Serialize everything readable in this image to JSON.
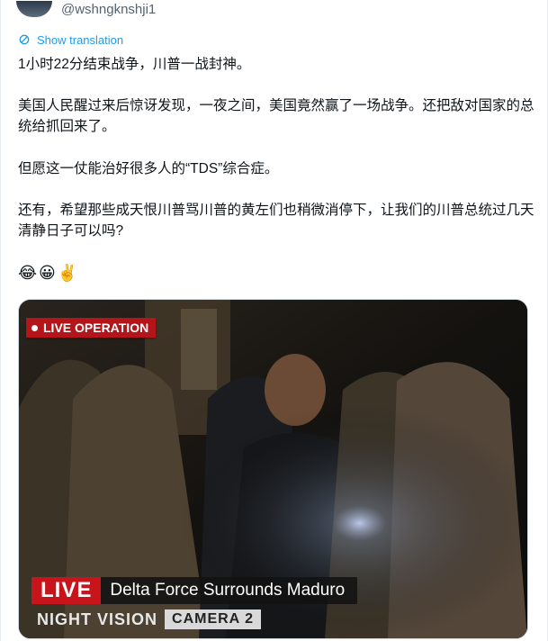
{
  "author": {
    "handle": "@wshngknshji1"
  },
  "translate": {
    "label": "Show translation"
  },
  "tweet": {
    "p1": "1小时22分结束战争，川普一战封神。",
    "p2": "美国人民醒过来后惊讶发现，一夜之间，美国竟然赢了一场战争。还把敌对国家的总统给抓回来了。",
    "p3": "但愿这一仗能治好很多人的“TDS”综合症。",
    "p4": "还有，希望那些成天恨川普骂川普的黄左们也稍微消停下，让我们的川普总统过几天清静日子可以吗?",
    "emojis": "😂😀✌️"
  },
  "media": {
    "badge": "LIVE OPERATION",
    "live_tag": "LIVE",
    "headline": "Delta Force Surrounds Maduro",
    "night_vision": "NIGHT VISION",
    "camera": "CAMERA 2"
  },
  "colors": {
    "link": "#1d9bf0",
    "live_red": "#c8151b",
    "text": "#0f1419"
  }
}
